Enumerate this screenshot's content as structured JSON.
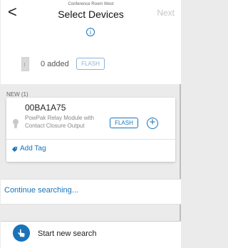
{
  "header": {
    "back_glyph": "<",
    "subtitle": "Conference Room West",
    "title": "Select Devices",
    "next_label": "Next"
  },
  "info": {
    "glyph": "i"
  },
  "added": {
    "text": "0 added",
    "flash_label": "FLASH"
  },
  "new_section": {
    "label": "NEW (1)",
    "devices": [
      {
        "id": "00BA1A75",
        "description": "PowPak Relay Module with Contact Closure Output",
        "flash_label": "FLASH",
        "add_glyph": "+",
        "add_tag_label": "Add Tag"
      }
    ]
  },
  "continue": {
    "label": "Continue searching..."
  },
  "start": {
    "label": "Start new search"
  },
  "colors": {
    "accent": "#1a73b8",
    "background": "#ebebeb",
    "disabled": "#c6c6c6"
  }
}
